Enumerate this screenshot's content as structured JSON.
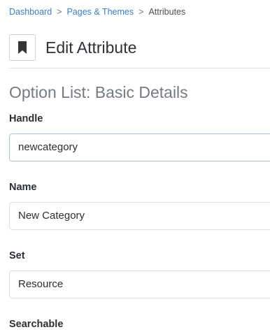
{
  "breadcrumb": {
    "items": [
      {
        "label": "Dashboard"
      },
      {
        "label": "Pages & Themes"
      }
    ],
    "separator": ">",
    "current": "Attributes"
  },
  "header": {
    "icon": "bookmark-icon",
    "title": "Edit Attribute"
  },
  "section": {
    "title": "Option List: Basic Details"
  },
  "form": {
    "handle": {
      "label": "Handle",
      "value": "newcategory"
    },
    "name": {
      "label": "Name",
      "value": "New Category"
    },
    "set": {
      "label": "Set",
      "value": "Resource"
    },
    "searchable": {
      "label": "Searchable"
    }
  },
  "colors": {
    "link": "#3a7fc1",
    "section_title": "#757b81",
    "focused_border": "#a6c3e0"
  }
}
